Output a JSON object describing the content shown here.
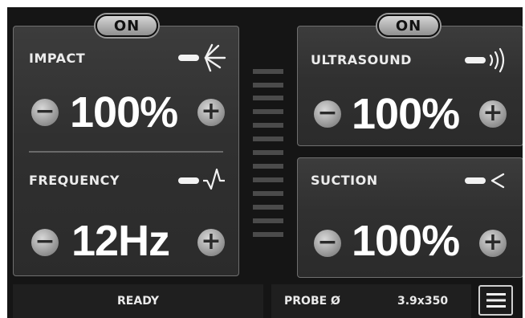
{
  "impact": {
    "toggle": "ON",
    "label": "IMPACT",
    "value": "100%",
    "icon": "impact-icon"
  },
  "frequency": {
    "label": "FREQUENCY",
    "value": "12Hz",
    "icon": "frequency-icon"
  },
  "ultrasound": {
    "toggle": "ON",
    "label": "ULTRASOUND",
    "value": "100%",
    "icon": "ultrasound-icon"
  },
  "suction": {
    "label": "SUCTION",
    "value": "100%",
    "icon": "suction-icon"
  },
  "controls": {
    "minus": "−",
    "plus": "+"
  },
  "status": {
    "ready": "READY",
    "probe_label": "PROBE Ø",
    "probe_value": "3.9x350"
  },
  "menu": {
    "icon": "hamburger-menu-icon"
  },
  "colors": {
    "background": "#151515",
    "panel": "#333333",
    "text": "#ffffff"
  }
}
